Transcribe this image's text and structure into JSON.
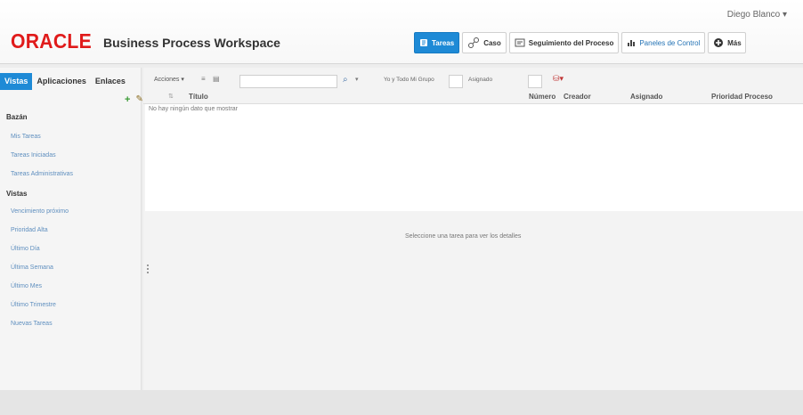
{
  "header": {
    "brand": "ORACLE",
    "app_title": "Business Process Workspace",
    "user_label": "Diego Blanco ▾",
    "nav": [
      {
        "label": "Tareas",
        "icon": "task-icon"
      },
      {
        "label": "Caso",
        "icon": "case-icon"
      },
      {
        "label": "Seguimiento del Proceso",
        "icon": "process-tracking-icon"
      },
      {
        "label": "Paneles de Control",
        "icon": "dashboard-icon"
      },
      {
        "label": "Más",
        "icon": "plus-circle-icon"
      }
    ],
    "colors": {
      "brand_red": "#e01b1b",
      "accent_blue": "#1e8ad6"
    }
  },
  "left_panel": {
    "tabs": [
      "Vistas",
      "Aplicaciones",
      "Enlaces"
    ],
    "section_basic": "Bazán",
    "links_basic": [
      "Mis Tareas",
      "Tareas Iniciadas",
      "Tareas Administrativas"
    ],
    "section_views": "Vistas",
    "links_views": [
      "Vencimiento próximo",
      "Prioridad Alta",
      "Último Día",
      "Última Semana",
      "Último Mes",
      "Último Trimestre",
      "Nuevas Tareas"
    ]
  },
  "toolbar": {
    "actions_label": "Acciones ▾",
    "filter_label": "Yo y Todo Mi Grupo",
    "assigned_label": "Asignado"
  },
  "table": {
    "columns": [
      "Título",
      "Número",
      "Creador",
      "Asignado",
      "Prioridad Proceso"
    ],
    "empty_message": "No hay ningún dato que mostrar"
  },
  "detail": {
    "hint": "Seleccione una tarea para ver los detalles"
  }
}
